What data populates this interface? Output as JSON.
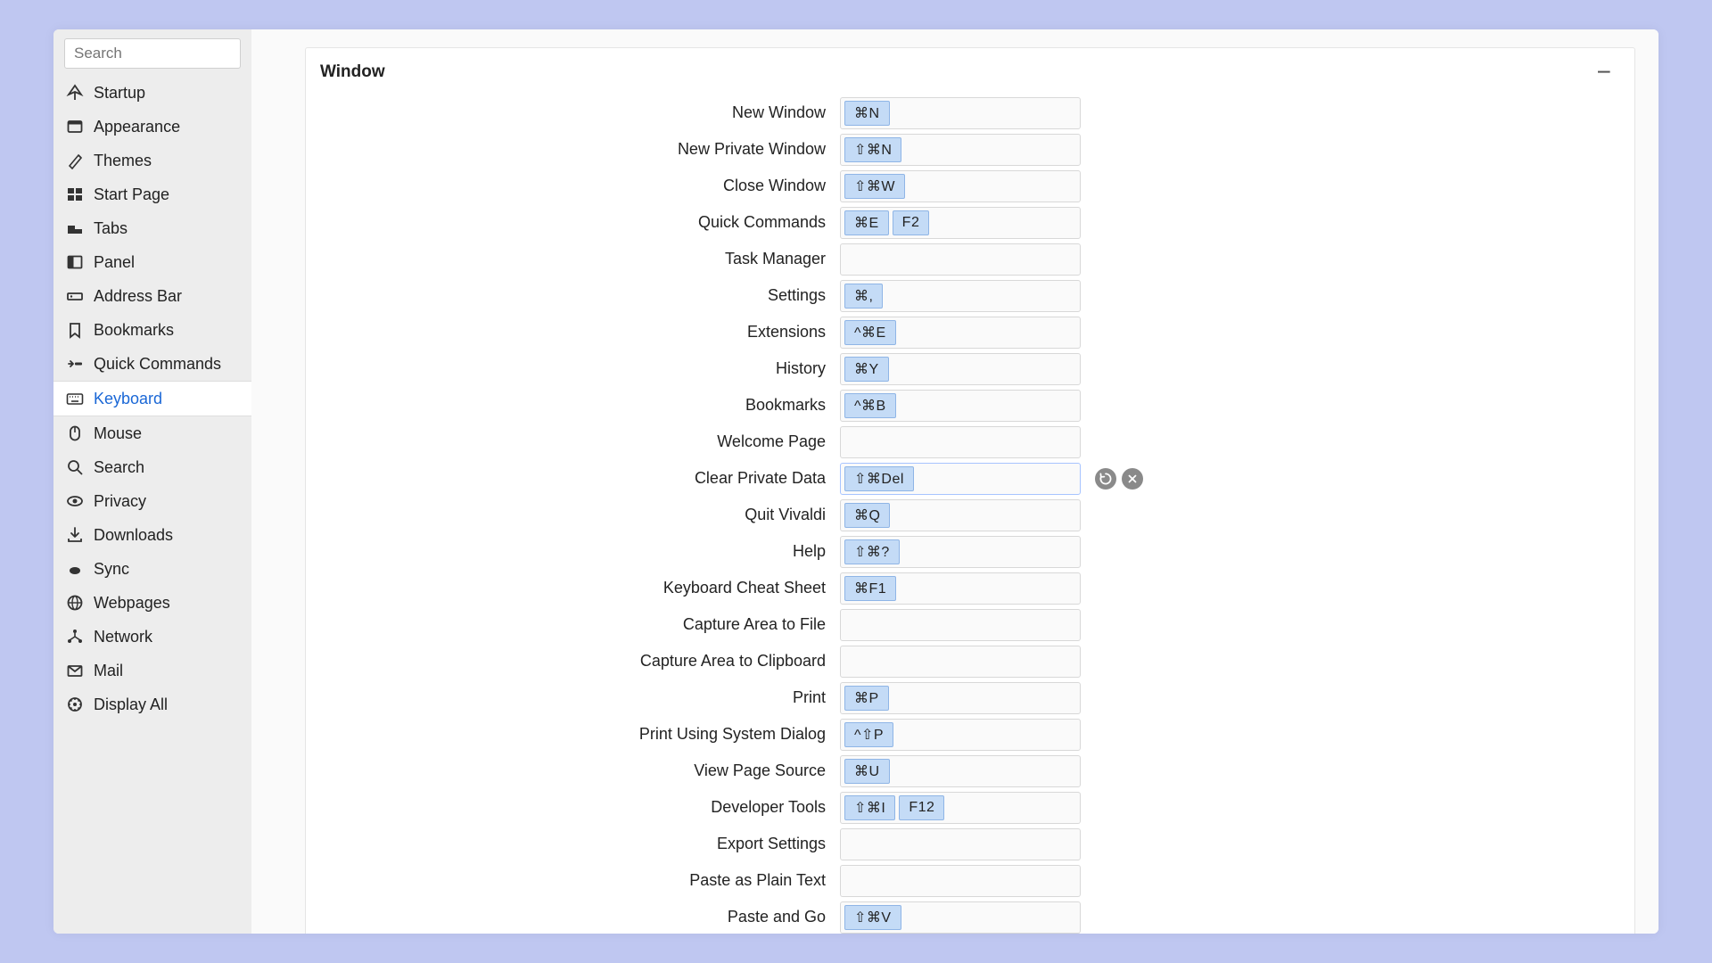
{
  "search": {
    "placeholder": "Search"
  },
  "sidebar": {
    "active": "keyboard",
    "items": [
      {
        "id": "startup",
        "label": "Startup",
        "icon": "startup-icon"
      },
      {
        "id": "appearance",
        "label": "Appearance",
        "icon": "appearance-icon"
      },
      {
        "id": "themes",
        "label": "Themes",
        "icon": "themes-icon"
      },
      {
        "id": "start-page",
        "label": "Start Page",
        "icon": "start-page-icon"
      },
      {
        "id": "tabs",
        "label": "Tabs",
        "icon": "tabs-icon"
      },
      {
        "id": "panel",
        "label": "Panel",
        "icon": "panel-icon"
      },
      {
        "id": "address-bar",
        "label": "Address Bar",
        "icon": "address-bar-icon"
      },
      {
        "id": "bookmarks",
        "label": "Bookmarks",
        "icon": "bookmarks-icon"
      },
      {
        "id": "quick-commands",
        "label": "Quick Commands",
        "icon": "quick-commands-icon"
      },
      {
        "id": "keyboard",
        "label": "Keyboard",
        "icon": "keyboard-icon"
      },
      {
        "id": "mouse",
        "label": "Mouse",
        "icon": "mouse-icon"
      },
      {
        "id": "search",
        "label": "Search",
        "icon": "search-icon"
      },
      {
        "id": "privacy",
        "label": "Privacy",
        "icon": "privacy-icon"
      },
      {
        "id": "downloads",
        "label": "Downloads",
        "icon": "downloads-icon"
      },
      {
        "id": "sync",
        "label": "Sync",
        "icon": "sync-icon"
      },
      {
        "id": "webpages",
        "label": "Webpages",
        "icon": "webpages-icon"
      },
      {
        "id": "network",
        "label": "Network",
        "icon": "network-icon"
      },
      {
        "id": "mail",
        "label": "Mail",
        "icon": "mail-icon"
      },
      {
        "id": "display-all",
        "label": "Display All",
        "icon": "display-all-icon"
      }
    ]
  },
  "section": {
    "title": "Window",
    "focused_row": 10,
    "rows": [
      {
        "label": "New Window",
        "shortcuts": [
          "⌘N"
        ]
      },
      {
        "label": "New Private Window",
        "shortcuts": [
          "⇧⌘N"
        ]
      },
      {
        "label": "Close Window",
        "shortcuts": [
          "⇧⌘W"
        ]
      },
      {
        "label": "Quick Commands",
        "shortcuts": [
          "⌘E",
          "F2"
        ]
      },
      {
        "label": "Task Manager",
        "shortcuts": []
      },
      {
        "label": "Settings",
        "shortcuts": [
          "⌘,"
        ]
      },
      {
        "label": "Extensions",
        "shortcuts": [
          "^⌘E"
        ]
      },
      {
        "label": "History",
        "shortcuts": [
          "⌘Y"
        ]
      },
      {
        "label": "Bookmarks",
        "shortcuts": [
          "^⌘B"
        ]
      },
      {
        "label": "Welcome Page",
        "shortcuts": []
      },
      {
        "label": "Clear Private Data",
        "shortcuts": [
          "⇧⌘Del"
        ]
      },
      {
        "label": "Quit Vivaldi",
        "shortcuts": [
          "⌘Q"
        ]
      },
      {
        "label": "Help",
        "shortcuts": [
          "⇧⌘?"
        ]
      },
      {
        "label": "Keyboard Cheat Sheet",
        "shortcuts": [
          "⌘F1"
        ]
      },
      {
        "label": "Capture Area to File",
        "shortcuts": []
      },
      {
        "label": "Capture Area to Clipboard",
        "shortcuts": []
      },
      {
        "label": "Print",
        "shortcuts": [
          "⌘P"
        ]
      },
      {
        "label": "Print Using System Dialog",
        "shortcuts": [
          "^⇧P"
        ]
      },
      {
        "label": "View Page Source",
        "shortcuts": [
          "⌘U"
        ]
      },
      {
        "label": "Developer Tools",
        "shortcuts": [
          "⇧⌘I",
          "F12"
        ]
      },
      {
        "label": "Export Settings",
        "shortcuts": []
      },
      {
        "label": "Paste as Plain Text",
        "shortcuts": []
      },
      {
        "label": "Paste and Go",
        "shortcuts": [
          "⇧⌘V"
        ]
      }
    ]
  }
}
